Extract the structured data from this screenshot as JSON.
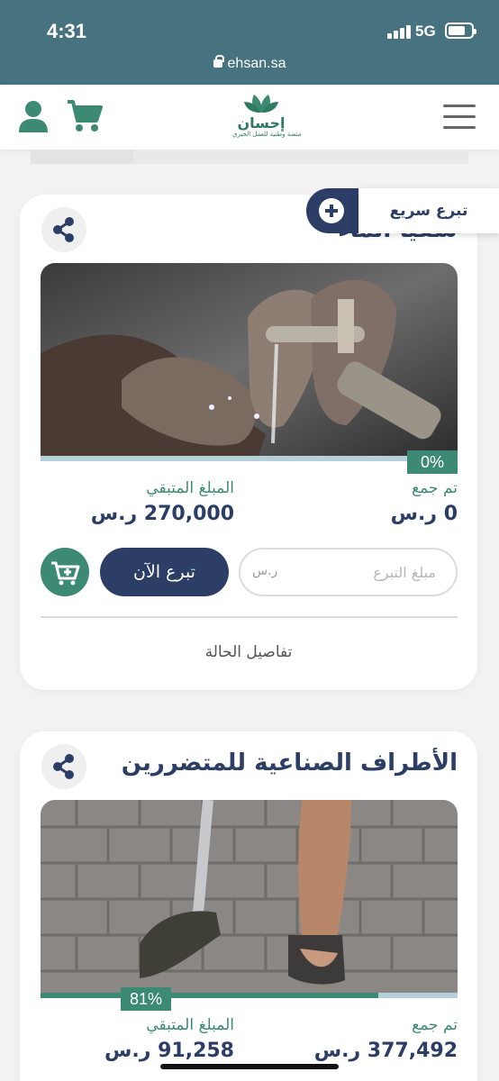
{
  "status": {
    "time": "4:31",
    "network": "5G"
  },
  "browser": {
    "url": "ehsan.sa"
  },
  "header": {
    "logo_name": "إحسان",
    "logo_tagline": "منصة وطنية للعمل الخيري"
  },
  "quick_donate": {
    "label": "تبرع سريع"
  },
  "cards": [
    {
      "title": "سقيا الماء",
      "progress_percent": "0%",
      "progress_fraction": 0.0,
      "collected_label": "تم جمع",
      "collected_value": "0 ر.س",
      "remaining_label": "المبلغ المتبقي",
      "remaining_value": "270,000 ر.س",
      "donate_label": "تبرع الآن",
      "amount_placeholder": "مبلغ التبرع",
      "currency_hint": "ر.س",
      "details_label": "تفاصيل الحالة"
    },
    {
      "title": "الأطراف الصناعية للمتضررين",
      "progress_percent": "81%",
      "progress_fraction": 0.81,
      "collected_label": "تم جمع",
      "collected_value": "377,492 ر.س",
      "remaining_label": "المبلغ المتبقي",
      "remaining_value": "91,258 ر.س"
    }
  ],
  "colors": {
    "brand_green": "#3d8a74",
    "brand_navy": "#2c3e66",
    "status_bar": "#477280"
  }
}
